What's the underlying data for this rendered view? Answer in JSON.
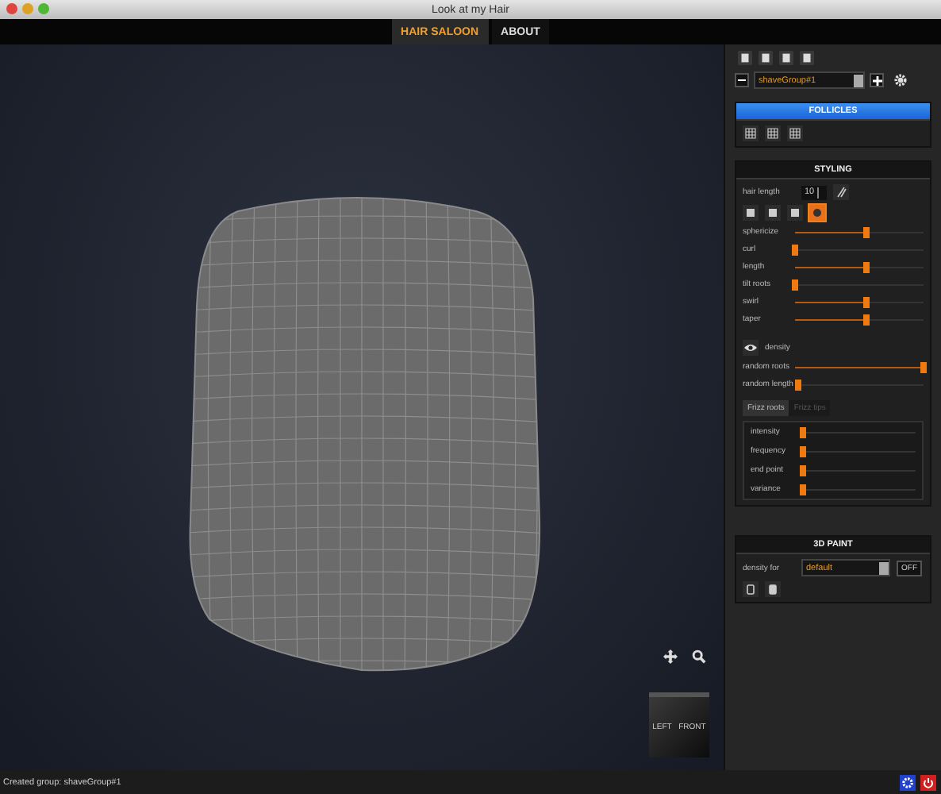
{
  "window": {
    "title": "Look at my Hair"
  },
  "tabs": [
    {
      "label": "HAIR SALOON",
      "selected": true
    },
    {
      "label": "ABOUT",
      "selected": false
    }
  ],
  "viewport": {
    "view_cube": {
      "left": "LEFT",
      "front": "FRONT"
    }
  },
  "group": {
    "value": "shaveGroup#1"
  },
  "follicles": {
    "title": "FOLLICLES"
  },
  "styling": {
    "title": "STYLING",
    "hair_length": {
      "label": "hair length",
      "value": "10"
    },
    "modes": [
      {
        "selected": false
      },
      {
        "selected": false
      },
      {
        "selected": false
      },
      {
        "selected": true
      }
    ],
    "sliders": [
      {
        "label": "sphericize",
        "level": 0.55
      },
      {
        "label": "curl",
        "level": 0.0
      },
      {
        "label": "length",
        "level": 0.55
      },
      {
        "label": "tilt roots",
        "level": 0.0
      },
      {
        "label": "swirl",
        "level": 0.55
      },
      {
        "label": "taper",
        "level": 0.55
      }
    ],
    "density": {
      "label": "density"
    },
    "random": [
      {
        "label": "random roots",
        "level": 1.0
      },
      {
        "label": "random length",
        "level": 0.0
      }
    ],
    "frizz_tabs": [
      {
        "label": "Frizz roots",
        "selected": true
      },
      {
        "label": "Frizz tips",
        "selected": false
      }
    ],
    "frizz": [
      {
        "label": "intensity",
        "level": 0.0
      },
      {
        "label": "frequency",
        "level": 0.0
      },
      {
        "label": "end point",
        "level": 0.0
      },
      {
        "label": "variance",
        "level": 0.0
      }
    ]
  },
  "paint": {
    "title": "3D PAINT",
    "label": "density for",
    "value": "default",
    "toggle": "OFF"
  },
  "status_bar": {
    "text": "Created group: shaveGroup#1"
  }
}
